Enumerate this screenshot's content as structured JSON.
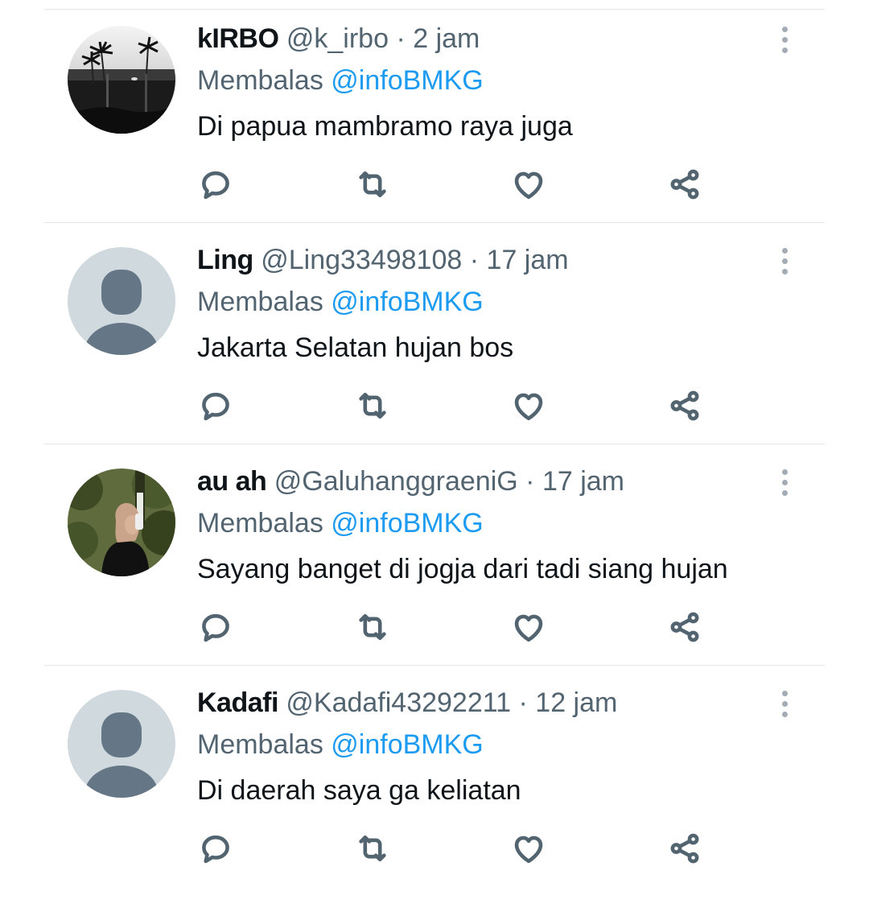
{
  "separator": "·",
  "tweets": [
    {
      "name": "kIRBO",
      "handle": "@k_irbo",
      "time": "2 jam",
      "reply_prefix": "Membalas",
      "reply_to": "@infoBMKG",
      "text": "Di papua mambramo raya juga",
      "avatar": "palm-photo"
    },
    {
      "name": "Ling",
      "handle": "@Ling33498108",
      "time": "17 jam",
      "reply_prefix": "Membalas",
      "reply_to": "@infoBMKG",
      "text": "Jakarta Selatan hujan bos",
      "avatar": "default-avatar"
    },
    {
      "name": "au ah",
      "handle": "@GaluhanggraeniG",
      "time": "17 jam",
      "reply_prefix": "Membalas",
      "reply_to": "@infoBMKG",
      "text": "Sayang banget di jogja dari tadi siang hujan",
      "avatar": "person-photo"
    },
    {
      "name": "Kadafi",
      "handle": "@Kadafi43292211",
      "time": "12 jam",
      "reply_prefix": "Membalas",
      "reply_to": "@infoBMKG",
      "text": "Di daerah saya ga keliatan",
      "avatar": "default-avatar"
    }
  ],
  "icons": {
    "reply": "reply-icon",
    "retweet": "retweet-icon",
    "like": "heart-icon",
    "share": "share-icon",
    "more": "more-vertical-icon"
  },
  "colors": {
    "link": "#1d9bf0",
    "secondary_text": "#536471",
    "primary_text": "#0f1419",
    "divider": "#e3e6e8"
  }
}
